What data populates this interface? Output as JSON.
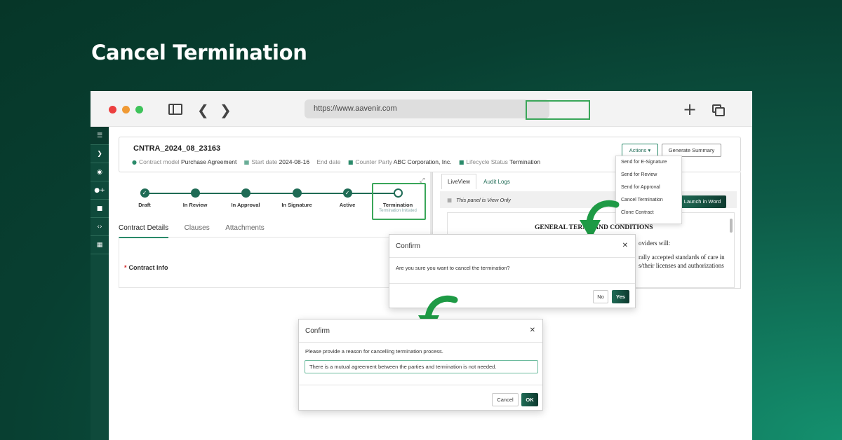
{
  "hero": {
    "title": "Cancel Termination"
  },
  "browser": {
    "url": "https://www.aavenir.com"
  },
  "contract": {
    "id": "CNTRA_2024_08_23163",
    "meta": {
      "model_label": "Contract model",
      "model_value": "Purchase Agreement",
      "start_label": "Start date",
      "start_value": "2024-08-16",
      "end_label": "End date",
      "counter_label": "Counter Party",
      "counter_value": "ABC Corporation, Inc.",
      "status_label": "Lifecycle Status",
      "status_value": "Termination"
    },
    "actions_label": "Actions ▾",
    "summary_label": "Generate Summary"
  },
  "stepper": {
    "steps": [
      {
        "label": "Draft"
      },
      {
        "label": "In Review"
      },
      {
        "label": "In Approval"
      },
      {
        "label": "In Signature"
      },
      {
        "label": "Active"
      },
      {
        "label": "Termination",
        "sub": "Termination Initiated"
      }
    ]
  },
  "detail_tabs": [
    "Contract Details",
    "Clauses",
    "Attachments"
  ],
  "contract_info_label": "Contract Info",
  "right_pane": {
    "tabs": [
      "LiveView",
      "Audit Logs"
    ],
    "view_only_note": "This panel is View Only",
    "launch_label": "Launch in Word",
    "doc_heading": "GENERAL TERMS AND CONDITIONS",
    "doc_line1": "oviders will:",
    "doc_line2": "rally accepted standards of care in",
    "doc_line3": "s/their licenses and authorizations"
  },
  "actions_menu": [
    "Send for E-Signature",
    "Send for Review",
    "Send for Approval",
    "Cancel Termination",
    "Clone Contract"
  ],
  "confirm1": {
    "title": "Confirm",
    "message": "Are you sure you want to cancel the termination?",
    "no_label": "No",
    "yes_label": "Yes"
  },
  "confirm2": {
    "title": "Confirm",
    "message": "Please provide a reason for cancelling termination process.",
    "reason_value": "There is a mutual agreement between the parties and termination is not needed.",
    "cancel_label": "Cancel",
    "ok_label": "OK"
  },
  "colors": {
    "brand_dark": "#0f4a3b",
    "brand": "#1f6b55",
    "highlight_green": "#3aa659",
    "arrow_green": "#1e9a45"
  },
  "icons": {
    "close": "close-icon",
    "user": "user-icon",
    "calendar": "calendar-icon",
    "book": "book-icon",
    "camera": "video-icon"
  }
}
